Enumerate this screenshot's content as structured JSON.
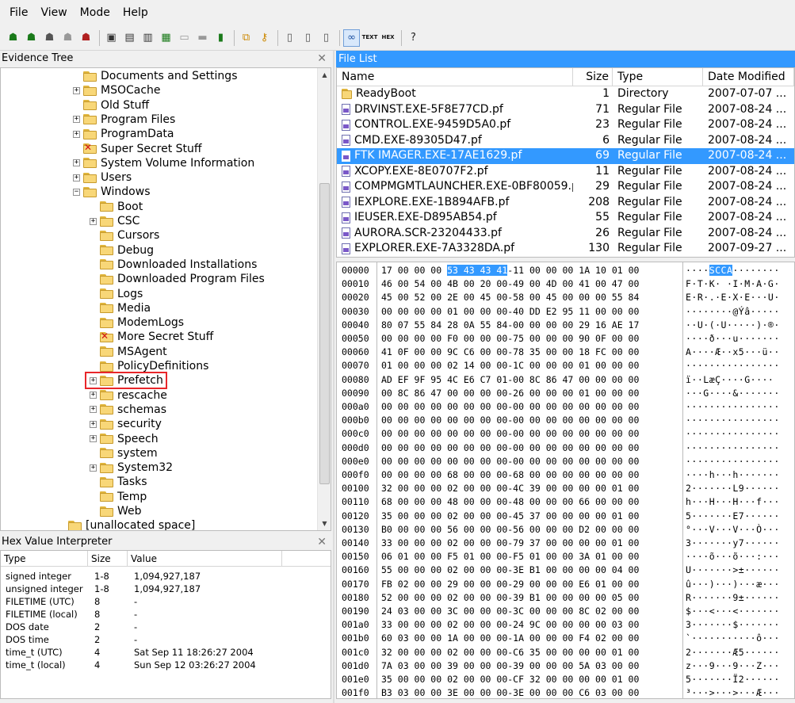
{
  "menu": [
    "File",
    "View",
    "Mode",
    "Help"
  ],
  "toolbar": {
    "icons": [
      "add-evidence-icon",
      "add-all-evidence-icon",
      "image-mounting-icon",
      "remove-evidence-icon",
      "remove-all-evidence-icon",
      "create-disk-image-icon",
      "export-disk-image-icon",
      "export-logical-image-icon",
      "add-to-custom-content-icon",
      "create-custom-image-icon",
      "verify-drive-icon",
      "capture-memory-icon",
      "obtain-protected-files-icon",
      "detect-encryption-icon",
      "help-icon"
    ],
    "text_labels": {
      "text_view": "TEXT",
      "hex_view": "HEX"
    }
  },
  "evidence_tree": {
    "title": "Evidence Tree",
    "items": [
      {
        "label": "Documents and Settings",
        "indent": 0,
        "expander": "",
        "x": false
      },
      {
        "label": "MSOCache",
        "indent": 0,
        "expander": "+",
        "x": false
      },
      {
        "label": "Old Stuff",
        "indent": 0,
        "expander": "",
        "x": false
      },
      {
        "label": "Program Files",
        "indent": 0,
        "expander": "+",
        "x": false
      },
      {
        "label": "ProgramData",
        "indent": 0,
        "expander": "+",
        "x": false
      },
      {
        "label": "Super Secret Stuff",
        "indent": 0,
        "expander": "",
        "x": true
      },
      {
        "label": "System Volume Information",
        "indent": 0,
        "expander": "+",
        "x": false
      },
      {
        "label": "Users",
        "indent": 0,
        "expander": "+",
        "x": false
      },
      {
        "label": "Windows",
        "indent": 0,
        "expander": "-",
        "x": false
      },
      {
        "label": "Boot",
        "indent": 1,
        "expander": "",
        "x": false
      },
      {
        "label": "CSC",
        "indent": 1,
        "expander": "+",
        "x": false
      },
      {
        "label": "Cursors",
        "indent": 1,
        "expander": "",
        "x": false
      },
      {
        "label": "Debug",
        "indent": 1,
        "expander": "",
        "x": false
      },
      {
        "label": "Downloaded Installations",
        "indent": 1,
        "expander": "",
        "x": false
      },
      {
        "label": "Downloaded Program Files",
        "indent": 1,
        "expander": "",
        "x": false
      },
      {
        "label": "Logs",
        "indent": 1,
        "expander": "",
        "x": false
      },
      {
        "label": "Media",
        "indent": 1,
        "expander": "",
        "x": false
      },
      {
        "label": "ModemLogs",
        "indent": 1,
        "expander": "",
        "x": false
      },
      {
        "label": "More Secret Stuff",
        "indent": 1,
        "expander": "",
        "x": true
      },
      {
        "label": "MSAgent",
        "indent": 1,
        "expander": "",
        "x": false
      },
      {
        "label": "PolicyDefinitions",
        "indent": 1,
        "expander": "",
        "x": false
      },
      {
        "label": "Prefetch",
        "indent": 1,
        "expander": "+",
        "x": false,
        "highlighted": true
      },
      {
        "label": "rescache",
        "indent": 1,
        "expander": "+",
        "x": false
      },
      {
        "label": "schemas",
        "indent": 1,
        "expander": "+",
        "x": false
      },
      {
        "label": "security",
        "indent": 1,
        "expander": "+",
        "x": false
      },
      {
        "label": "Speech",
        "indent": 1,
        "expander": "+",
        "x": false
      },
      {
        "label": "system",
        "indent": 1,
        "expander": "",
        "x": false
      },
      {
        "label": "System32",
        "indent": 1,
        "expander": "+",
        "x": false
      },
      {
        "label": "Tasks",
        "indent": 1,
        "expander": "",
        "x": false
      },
      {
        "label": "Temp",
        "indent": 1,
        "expander": "",
        "x": false
      },
      {
        "label": "Web",
        "indent": 1,
        "expander": "",
        "x": false
      },
      {
        "label": "[unallocated space]",
        "indent": -1,
        "expander": "",
        "x": false
      }
    ]
  },
  "hex_interpreter": {
    "title": "Hex Value Interpreter",
    "columns": [
      "Type",
      "Size",
      "Value"
    ],
    "rows": [
      [
        "signed integer",
        "1-8",
        "1,094,927,187"
      ],
      [
        "unsigned integer",
        "1-8",
        "1,094,927,187"
      ],
      [
        "FILETIME (UTC)",
        "8",
        "-"
      ],
      [
        "FILETIME (local)",
        "8",
        "-"
      ],
      [
        "DOS date",
        "2",
        "-"
      ],
      [
        "DOS time",
        "2",
        "-"
      ],
      [
        "time_t (UTC)",
        "4",
        "Sat Sep 11 18:26:27 2004"
      ],
      [
        "time_t (local)",
        "4",
        "Sun Sep 12 03:26:27 2004"
      ]
    ]
  },
  "file_list": {
    "title": "File List",
    "columns": {
      "name": "Name",
      "size": "Size",
      "type": "Type",
      "date": "Date Modified"
    },
    "rows": [
      {
        "name": "ReadyBoot",
        "size": "1",
        "type": "Directory",
        "date": "2007-07-07 ...",
        "icon": "folder",
        "selected": false
      },
      {
        "name": "DRVINST.EXE-5F8E77CD.pf",
        "size": "71",
        "type": "Regular File",
        "date": "2007-08-24 ...",
        "icon": "file",
        "selected": false
      },
      {
        "name": "CONTROL.EXE-9459D5A0.pf",
        "size": "23",
        "type": "Regular File",
        "date": "2007-08-24 ...",
        "icon": "file",
        "selected": false
      },
      {
        "name": "CMD.EXE-89305D47.pf",
        "size": "6",
        "type": "Regular File",
        "date": "2007-08-24 ...",
        "icon": "file",
        "selected": false
      },
      {
        "name": "FTK IMAGER.EXE-17AE1629.pf",
        "size": "69",
        "type": "Regular File",
        "date": "2007-08-24 ...",
        "icon": "file",
        "selected": true
      },
      {
        "name": "XCOPY.EXE-8E0707F2.pf",
        "size": "11",
        "type": "Regular File",
        "date": "2007-08-24 ...",
        "icon": "file",
        "selected": false
      },
      {
        "name": "COMPMGMTLAUNCHER.EXE-0BF80059.pf",
        "size": "29",
        "type": "Regular File",
        "date": "2007-08-24 ...",
        "icon": "file",
        "selected": false
      },
      {
        "name": "IEXPLORE.EXE-1B894AFB.pf",
        "size": "208",
        "type": "Regular File",
        "date": "2007-08-24 ...",
        "icon": "file",
        "selected": false
      },
      {
        "name": "IEUSER.EXE-D895AB54.pf",
        "size": "55",
        "type": "Regular File",
        "date": "2007-08-24 ...",
        "icon": "file",
        "selected": false
      },
      {
        "name": "AURORA.SCR-23204433.pf",
        "size": "26",
        "type": "Regular File",
        "date": "2007-08-24 ...",
        "icon": "file",
        "selected": false
      },
      {
        "name": "EXPLORER.EXE-7A3328DA.pf",
        "size": "130",
        "type": "Regular File",
        "date": "2007-09-27 ...",
        "icon": "file",
        "selected": false
      }
    ]
  },
  "hex_view": {
    "rows": [
      {
        "offset": "00000",
        "bytes": "17 00 00 00 53 43 43 41-11 00 00 00 1A 10 01 00",
        "ascii": "····SCCA········",
        "sel": [
          4,
          7
        ]
      },
      {
        "offset": "00010",
        "bytes": "46 00 54 00 4B 00 20 00-49 00 4D 00 41 00 47 00",
        "ascii": "F·T·K· ·I·M·A·G·"
      },
      {
        "offset": "00020",
        "bytes": "45 00 52 00 2E 00 45 00-58 00 45 00 00 00 55 84",
        "ascii": "E·R·.·E·X·E···U·"
      },
      {
        "offset": "00030",
        "bytes": "00 00 00 00 01 00 00 00-40 DD E2 95 11 00 00 00",
        "ascii": "········@Ýâ·····"
      },
      {
        "offset": "00040",
        "bytes": "80 07 55 84 28 0A 55 84-00 00 00 00 29 16 AE 17",
        "ascii": "··U·(·U·····)·®·"
      },
      {
        "offset": "00050",
        "bytes": "00 00 00 00 F0 00 00 00-75 00 00 00 90 0F 00 00",
        "ascii": "····ð···u·······"
      },
      {
        "offset": "00060",
        "bytes": "41 0F 00 00 9C C6 00 00-78 35 00 00 18 FC 00 00",
        "ascii": "A····Æ··x5···ü··"
      },
      {
        "offset": "00070",
        "bytes": "01 00 00 00 02 14 00 00-1C 00 00 00 01 00 00 00",
        "ascii": "················"
      },
      {
        "offset": "00080",
        "bytes": "AD EF 9F 95 4C E6 C7 01-00 8C 86 47 00 00 00 00",
        "ascii": "­ï··LæÇ····G····"
      },
      {
        "offset": "00090",
        "bytes": "00 8C 86 47 00 00 00 00-26 00 00 00 01 00 00 00",
        "ascii": "···G····&·······"
      },
      {
        "offset": "000a0",
        "bytes": "00 00 00 00 00 00 00 00-00 00 00 00 00 00 00 00",
        "ascii": "················"
      },
      {
        "offset": "000b0",
        "bytes": "00 00 00 00 00 00 00 00-00 00 00 00 00 00 00 00",
        "ascii": "················"
      },
      {
        "offset": "000c0",
        "bytes": "00 00 00 00 00 00 00 00-00 00 00 00 00 00 00 00",
        "ascii": "················"
      },
      {
        "offset": "000d0",
        "bytes": "00 00 00 00 00 00 00 00-00 00 00 00 00 00 00 00",
        "ascii": "················"
      },
      {
        "offset": "000e0",
        "bytes": "00 00 00 00 00 00 00 00-00 00 00 00 00 00 00 00",
        "ascii": "················"
      },
      {
        "offset": "000f0",
        "bytes": "00 00 00 00 68 00 00 00-68 00 00 00 00 00 00 00",
        "ascii": "····h···h·······"
      },
      {
        "offset": "00100",
        "bytes": "32 00 00 00 02 00 00 00-4C 39 00 00 00 00 01 00",
        "ascii": "2·······L9······"
      },
      {
        "offset": "00110",
        "bytes": "68 00 00 00 48 00 00 00-48 00 00 00 66 00 00 00",
        "ascii": "h···H···H···f···"
      },
      {
        "offset": "00120",
        "bytes": "35 00 00 00 02 00 00 00-45 37 00 00 00 00 01 00",
        "ascii": "5·······E7······"
      },
      {
        "offset": "00130",
        "bytes": "B0 00 00 00 56 00 00 00-56 00 00 00 D2 00 00 00",
        "ascii": "°···V···V···Ò···"
      },
      {
        "offset": "00140",
        "bytes": "33 00 00 00 02 00 00 00-79 37 00 00 00 00 01 00",
        "ascii": "3·······y7······"
      },
      {
        "offset": "00150",
        "bytes": "06 01 00 00 F5 01 00 00-F5 01 00 00 3A 01 00 00",
        "ascii": "····õ···õ···:···"
      },
      {
        "offset": "00160",
        "bytes": "55 00 00 00 02 00 00 00-3E B1 00 00 00 00 04 00",
        "ascii": "U·······>±······"
      },
      {
        "offset": "00170",
        "bytes": "FB 02 00 00 29 00 00 00-29 00 00 00 E6 01 00 00",
        "ascii": "û···)···)···æ···"
      },
      {
        "offset": "00180",
        "bytes": "52 00 00 00 02 00 00 00-39 B1 00 00 00 00 05 00",
        "ascii": "R·······9±······"
      },
      {
        "offset": "00190",
        "bytes": "24 03 00 00 3C 00 00 00-3C 00 00 00 8C 02 00 00",
        "ascii": "$···<···<·······"
      },
      {
        "offset": "001a0",
        "bytes": "33 00 00 00 02 00 00 00-24 9C 00 00 00 00 03 00",
        "ascii": "3·······$·······"
      },
      {
        "offset": "001b0",
        "bytes": "60 03 00 00 1A 00 00 00-1A 00 00 00 F4 02 00 00",
        "ascii": "`···········ô···"
      },
      {
        "offset": "001c0",
        "bytes": "32 00 00 00 02 00 00 00-C6 35 00 00 00 00 01 00",
        "ascii": "2·······Æ5······"
      },
      {
        "offset": "001d0",
        "bytes": "7A 03 00 00 39 00 00 00-39 00 00 00 5A 03 00 00",
        "ascii": "z···9···9···Z···"
      },
      {
        "offset": "001e0",
        "bytes": "35 00 00 00 02 00 00 00-CF 32 00 00 00 00 01 00",
        "ascii": "5·······Ï2······"
      },
      {
        "offset": "001f0",
        "bytes": "B3 03 00 00 3E 00 00 00-3E 00 00 00 C6 03 00 00",
        "ascii": "³···>···>···Æ···"
      }
    ]
  }
}
